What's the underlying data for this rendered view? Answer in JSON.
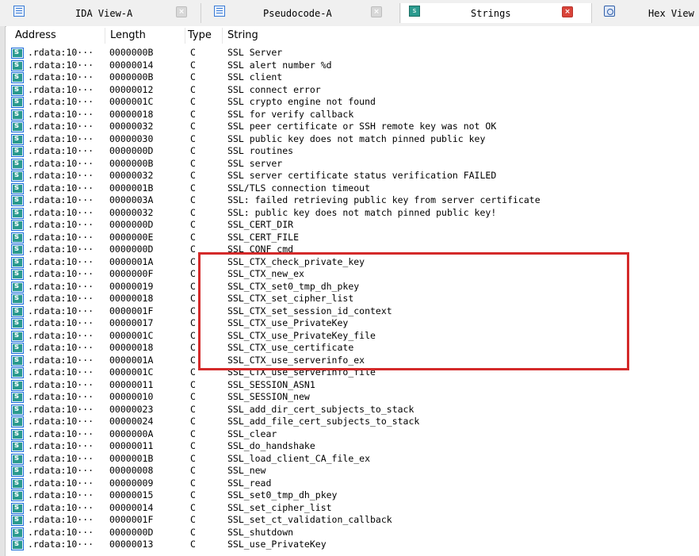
{
  "tabs": [
    {
      "label": "IDA View-A",
      "icon": "ida-view-icon",
      "active": false
    },
    {
      "label": "Pseudocode-A",
      "icon": "pseudocode-icon",
      "active": false
    },
    {
      "label": "Strings",
      "icon": "strings-icon",
      "active": true
    },
    {
      "label": "Hex View",
      "icon": "hex-view-icon",
      "active": false
    }
  ],
  "tab_close_glyph": "×",
  "tab_icon_strings_text": "s",
  "columns": {
    "address": "Address",
    "length": "Length",
    "type": "Type",
    "string": "String"
  },
  "colors": {
    "highlight_border": "#d42a2a",
    "active_close": "#d9443a",
    "string_icon": "#2a9a8e"
  },
  "rows": [
    {
      "address": ".rdata:10···",
      "length": "0000000B",
      "type": "C",
      "string": "SSL Server"
    },
    {
      "address": ".rdata:10···",
      "length": "00000014",
      "type": "C",
      "string": "SSL alert number %d"
    },
    {
      "address": ".rdata:10···",
      "length": "0000000B",
      "type": "C",
      "string": "SSL client"
    },
    {
      "address": ".rdata:10···",
      "length": "00000012",
      "type": "C",
      "string": "SSL connect error"
    },
    {
      "address": ".rdata:10···",
      "length": "0000001C",
      "type": "C",
      "string": "SSL crypto engine not found"
    },
    {
      "address": ".rdata:10···",
      "length": "00000018",
      "type": "C",
      "string": "SSL for verify callback"
    },
    {
      "address": ".rdata:10···",
      "length": "00000032",
      "type": "C",
      "string": "SSL peer certificate or SSH remote key was not OK"
    },
    {
      "address": ".rdata:10···",
      "length": "00000030",
      "type": "C",
      "string": "SSL public key does not match pinned public key"
    },
    {
      "address": ".rdata:10···",
      "length": "0000000D",
      "type": "C",
      "string": "SSL routines"
    },
    {
      "address": ".rdata:10···",
      "length": "0000000B",
      "type": "C",
      "string": "SSL server"
    },
    {
      "address": ".rdata:10···",
      "length": "00000032",
      "type": "C",
      "string": "SSL server certificate status verification FAILED"
    },
    {
      "address": ".rdata:10···",
      "length": "0000001B",
      "type": "C",
      "string": "SSL/TLS connection timeout"
    },
    {
      "address": ".rdata:10···",
      "length": "0000003A",
      "type": "C",
      "string": "SSL: failed retrieving public key from server certificate"
    },
    {
      "address": ".rdata:10···",
      "length": "00000032",
      "type": "C",
      "string": "SSL: public key does not match pinned public key!"
    },
    {
      "address": ".rdata:10···",
      "length": "0000000D",
      "type": "C",
      "string": "SSL_CERT_DIR"
    },
    {
      "address": ".rdata:10···",
      "length": "0000000E",
      "type": "C",
      "string": "SSL_CERT_FILE"
    },
    {
      "address": ".rdata:10···",
      "length": "0000000D",
      "type": "C",
      "string": "SSL_CONF_cmd"
    },
    {
      "address": ".rdata:10···",
      "length": "0000001A",
      "type": "C",
      "string": "SSL_CTX_check_private_key"
    },
    {
      "address": ".rdata:10···",
      "length": "0000000F",
      "type": "C",
      "string": "SSL_CTX_new_ex"
    },
    {
      "address": ".rdata:10···",
      "length": "00000019",
      "type": "C",
      "string": "SSL_CTX_set0_tmp_dh_pkey"
    },
    {
      "address": ".rdata:10···",
      "length": "00000018",
      "type": "C",
      "string": "SSL_CTX_set_cipher_list"
    },
    {
      "address": ".rdata:10···",
      "length": "0000001F",
      "type": "C",
      "string": "SSL_CTX_set_session_id_context"
    },
    {
      "address": ".rdata:10···",
      "length": "00000017",
      "type": "C",
      "string": "SSL_CTX_use_PrivateKey"
    },
    {
      "address": ".rdata:10···",
      "length": "0000001C",
      "type": "C",
      "string": "SSL_CTX_use_PrivateKey_file"
    },
    {
      "address": ".rdata:10···",
      "length": "00000018",
      "type": "C",
      "string": "SSL_CTX_use_certificate"
    },
    {
      "address": ".rdata:10···",
      "length": "0000001A",
      "type": "C",
      "string": "SSL_CTX_use_serverinfo_ex"
    },
    {
      "address": ".rdata:10···",
      "length": "0000001C",
      "type": "C",
      "string": "SSL_CTX_use_serverinfo_file"
    },
    {
      "address": ".rdata:10···",
      "length": "00000011",
      "type": "C",
      "string": "SSL_SESSION_ASN1"
    },
    {
      "address": ".rdata:10···",
      "length": "00000010",
      "type": "C",
      "string": "SSL_SESSION_new"
    },
    {
      "address": ".rdata:10···",
      "length": "00000023",
      "type": "C",
      "string": "SSL_add_dir_cert_subjects_to_stack"
    },
    {
      "address": ".rdata:10···",
      "length": "00000024",
      "type": "C",
      "string": "SSL_add_file_cert_subjects_to_stack"
    },
    {
      "address": ".rdata:10···",
      "length": "0000000A",
      "type": "C",
      "string": "SSL_clear"
    },
    {
      "address": ".rdata:10···",
      "length": "00000011",
      "type": "C",
      "string": "SSL_do_handshake"
    },
    {
      "address": ".rdata:10···",
      "length": "0000001B",
      "type": "C",
      "string": "SSL_load_client_CA_file_ex"
    },
    {
      "address": ".rdata:10···",
      "length": "00000008",
      "type": "C",
      "string": "SSL_new"
    },
    {
      "address": ".rdata:10···",
      "length": "00000009",
      "type": "C",
      "string": "SSL_read"
    },
    {
      "address": ".rdata:10···",
      "length": "00000015",
      "type": "C",
      "string": "SSL_set0_tmp_dh_pkey"
    },
    {
      "address": ".rdata:10···",
      "length": "00000014",
      "type": "C",
      "string": "SSL_set_cipher_list"
    },
    {
      "address": ".rdata:10···",
      "length": "0000001F",
      "type": "C",
      "string": "SSL_set_ct_validation_callback"
    },
    {
      "address": ".rdata:10···",
      "length": "0000000D",
      "type": "C",
      "string": "SSL_shutdown"
    },
    {
      "address": ".rdata:10···",
      "length": "00000013",
      "type": "C",
      "string": "SSL_use_PrivateKey"
    }
  ]
}
